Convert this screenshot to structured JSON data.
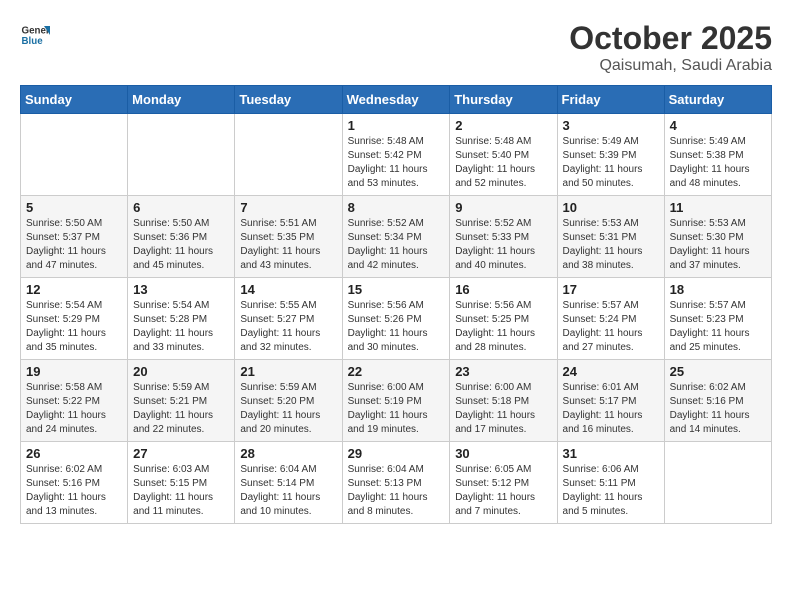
{
  "logo": {
    "line1": "General",
    "line2": "Blue"
  },
  "title": "October 2025",
  "location": "Qaisumah, Saudi Arabia",
  "days_header": [
    "Sunday",
    "Monday",
    "Tuesday",
    "Wednesday",
    "Thursday",
    "Friday",
    "Saturday"
  ],
  "weeks": [
    [
      {
        "day": "",
        "info": ""
      },
      {
        "day": "",
        "info": ""
      },
      {
        "day": "",
        "info": ""
      },
      {
        "day": "1",
        "info": "Sunrise: 5:48 AM\nSunset: 5:42 PM\nDaylight: 11 hours\nand 53 minutes."
      },
      {
        "day": "2",
        "info": "Sunrise: 5:48 AM\nSunset: 5:40 PM\nDaylight: 11 hours\nand 52 minutes."
      },
      {
        "day": "3",
        "info": "Sunrise: 5:49 AM\nSunset: 5:39 PM\nDaylight: 11 hours\nand 50 minutes."
      },
      {
        "day": "4",
        "info": "Sunrise: 5:49 AM\nSunset: 5:38 PM\nDaylight: 11 hours\nand 48 minutes."
      }
    ],
    [
      {
        "day": "5",
        "info": "Sunrise: 5:50 AM\nSunset: 5:37 PM\nDaylight: 11 hours\nand 47 minutes."
      },
      {
        "day": "6",
        "info": "Sunrise: 5:50 AM\nSunset: 5:36 PM\nDaylight: 11 hours\nand 45 minutes."
      },
      {
        "day": "7",
        "info": "Sunrise: 5:51 AM\nSunset: 5:35 PM\nDaylight: 11 hours\nand 43 minutes."
      },
      {
        "day": "8",
        "info": "Sunrise: 5:52 AM\nSunset: 5:34 PM\nDaylight: 11 hours\nand 42 minutes."
      },
      {
        "day": "9",
        "info": "Sunrise: 5:52 AM\nSunset: 5:33 PM\nDaylight: 11 hours\nand 40 minutes."
      },
      {
        "day": "10",
        "info": "Sunrise: 5:53 AM\nSunset: 5:31 PM\nDaylight: 11 hours\nand 38 minutes."
      },
      {
        "day": "11",
        "info": "Sunrise: 5:53 AM\nSunset: 5:30 PM\nDaylight: 11 hours\nand 37 minutes."
      }
    ],
    [
      {
        "day": "12",
        "info": "Sunrise: 5:54 AM\nSunset: 5:29 PM\nDaylight: 11 hours\nand 35 minutes."
      },
      {
        "day": "13",
        "info": "Sunrise: 5:54 AM\nSunset: 5:28 PM\nDaylight: 11 hours\nand 33 minutes."
      },
      {
        "day": "14",
        "info": "Sunrise: 5:55 AM\nSunset: 5:27 PM\nDaylight: 11 hours\nand 32 minutes."
      },
      {
        "day": "15",
        "info": "Sunrise: 5:56 AM\nSunset: 5:26 PM\nDaylight: 11 hours\nand 30 minutes."
      },
      {
        "day": "16",
        "info": "Sunrise: 5:56 AM\nSunset: 5:25 PM\nDaylight: 11 hours\nand 28 minutes."
      },
      {
        "day": "17",
        "info": "Sunrise: 5:57 AM\nSunset: 5:24 PM\nDaylight: 11 hours\nand 27 minutes."
      },
      {
        "day": "18",
        "info": "Sunrise: 5:57 AM\nSunset: 5:23 PM\nDaylight: 11 hours\nand 25 minutes."
      }
    ],
    [
      {
        "day": "19",
        "info": "Sunrise: 5:58 AM\nSunset: 5:22 PM\nDaylight: 11 hours\nand 24 minutes."
      },
      {
        "day": "20",
        "info": "Sunrise: 5:59 AM\nSunset: 5:21 PM\nDaylight: 11 hours\nand 22 minutes."
      },
      {
        "day": "21",
        "info": "Sunrise: 5:59 AM\nSunset: 5:20 PM\nDaylight: 11 hours\nand 20 minutes."
      },
      {
        "day": "22",
        "info": "Sunrise: 6:00 AM\nSunset: 5:19 PM\nDaylight: 11 hours\nand 19 minutes."
      },
      {
        "day": "23",
        "info": "Sunrise: 6:00 AM\nSunset: 5:18 PM\nDaylight: 11 hours\nand 17 minutes."
      },
      {
        "day": "24",
        "info": "Sunrise: 6:01 AM\nSunset: 5:17 PM\nDaylight: 11 hours\nand 16 minutes."
      },
      {
        "day": "25",
        "info": "Sunrise: 6:02 AM\nSunset: 5:16 PM\nDaylight: 11 hours\nand 14 minutes."
      }
    ],
    [
      {
        "day": "26",
        "info": "Sunrise: 6:02 AM\nSunset: 5:16 PM\nDaylight: 11 hours\nand 13 minutes."
      },
      {
        "day": "27",
        "info": "Sunrise: 6:03 AM\nSunset: 5:15 PM\nDaylight: 11 hours\nand 11 minutes."
      },
      {
        "day": "28",
        "info": "Sunrise: 6:04 AM\nSunset: 5:14 PM\nDaylight: 11 hours\nand 10 minutes."
      },
      {
        "day": "29",
        "info": "Sunrise: 6:04 AM\nSunset: 5:13 PM\nDaylight: 11 hours\nand 8 minutes."
      },
      {
        "day": "30",
        "info": "Sunrise: 6:05 AM\nSunset: 5:12 PM\nDaylight: 11 hours\nand 7 minutes."
      },
      {
        "day": "31",
        "info": "Sunrise: 6:06 AM\nSunset: 5:11 PM\nDaylight: 11 hours\nand 5 minutes."
      },
      {
        "day": "",
        "info": ""
      }
    ]
  ]
}
